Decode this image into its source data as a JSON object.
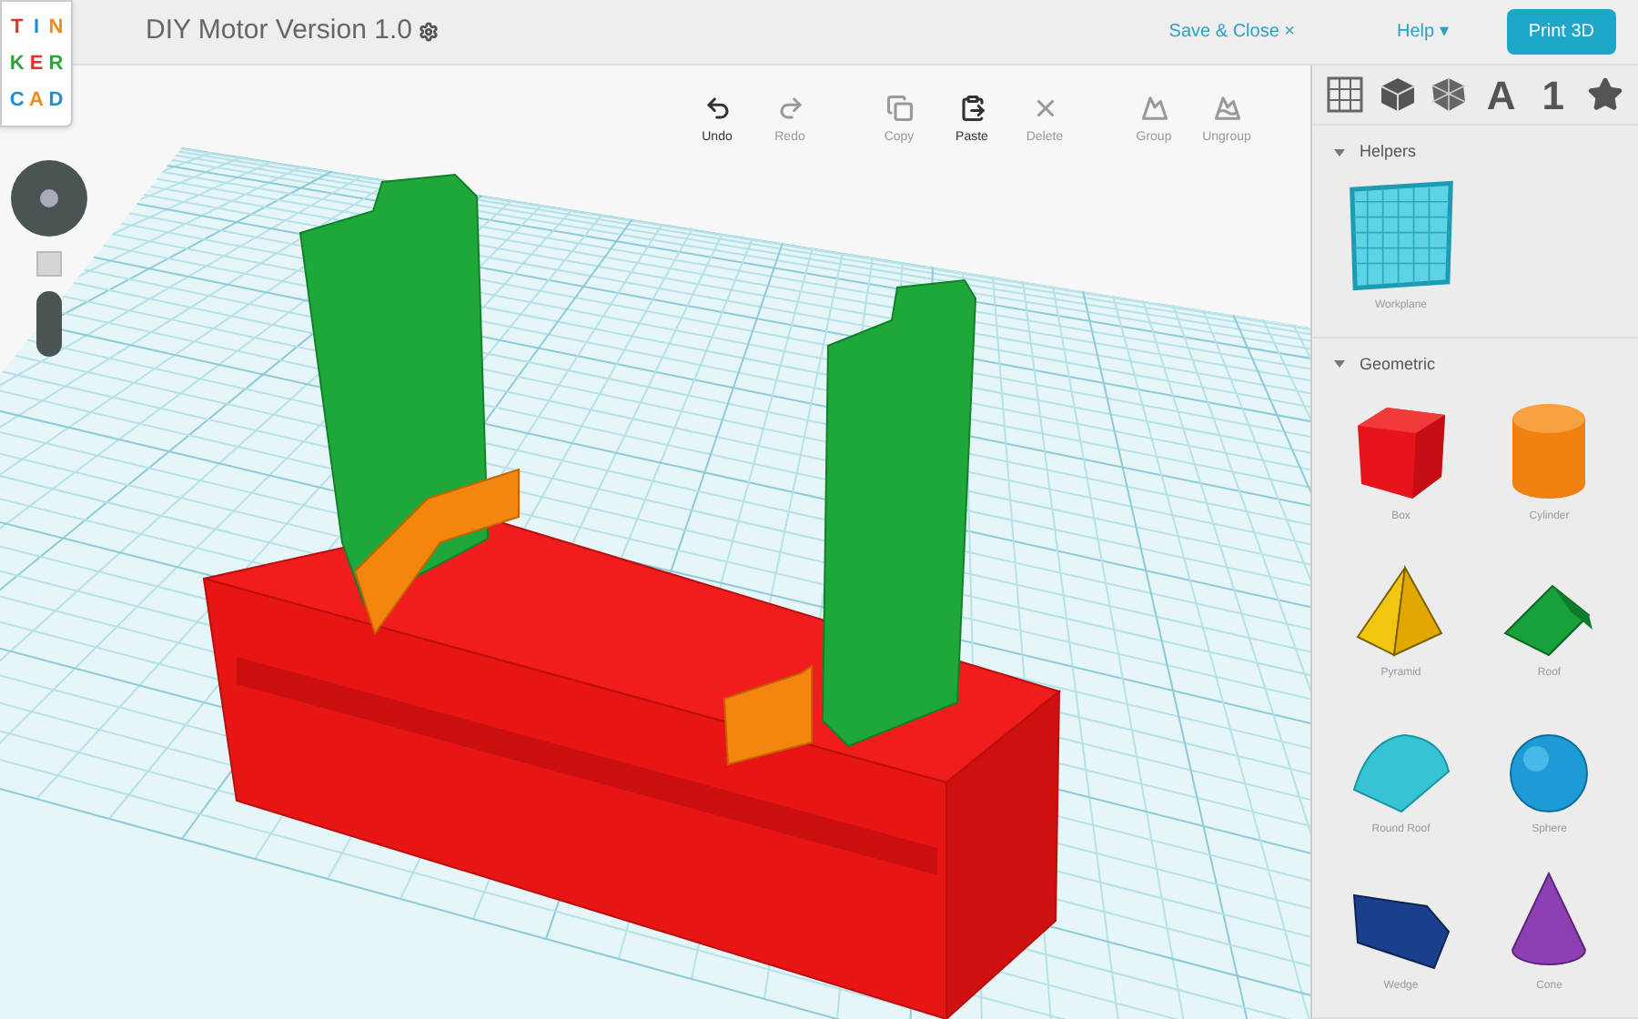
{
  "logo": {
    "letters": [
      {
        "char": "T",
        "color": "#e5302a"
      },
      {
        "char": "I",
        "color": "#1a8fd6"
      },
      {
        "char": "N",
        "color": "#f28b1c"
      },
      {
        "char": "K",
        "color": "#2aa53b"
      },
      {
        "char": "E",
        "color": "#e5302a"
      },
      {
        "char": "R",
        "color": "#2aa53b"
      },
      {
        "char": "C",
        "color": "#1a8fd6"
      },
      {
        "char": "A",
        "color": "#f28b1c"
      },
      {
        "char": "D",
        "color": "#1a8fd6"
      }
    ]
  },
  "title": "DIY Motor Version 1.0",
  "header": {
    "save_close": "Save & Close",
    "save_close_icon": "×",
    "help": "Help",
    "help_icon": "▾",
    "print_button": "Print 3D"
  },
  "toolbar": [
    {
      "kind": "undo",
      "label": "Undo",
      "disabled": false
    },
    {
      "kind": "redo",
      "label": "Redo",
      "disabled": true
    },
    {
      "kind": "copy",
      "label": "Copy",
      "disabled": true
    },
    {
      "kind": "paste",
      "label": "Paste",
      "disabled": false
    },
    {
      "kind": "delete",
      "label": "Delete",
      "disabled": true
    },
    {
      "kind": "group",
      "label": "Group",
      "disabled": true
    },
    {
      "kind": "ungroup",
      "label": "Ungroup",
      "disabled": true
    }
  ],
  "sidebar": {
    "tabs": [
      {
        "kind": "grid"
      },
      {
        "kind": "cube"
      },
      {
        "kind": "sphere"
      },
      {
        "kind": "text",
        "label": "A"
      },
      {
        "kind": "text",
        "label": "1"
      },
      {
        "kind": "star"
      }
    ],
    "sections": [
      {
        "title": "Helpers",
        "expanded": true,
        "items": [
          {
            "kind": "workplane",
            "label": "Workplane"
          }
        ]
      },
      {
        "title": "Geometric",
        "expanded": true,
        "items": [
          {
            "kind": "box",
            "label": "Box"
          },
          {
            "kind": "cylinder",
            "label": "Cylinder"
          },
          {
            "kind": "pyramid",
            "label": "Pyramid"
          },
          {
            "kind": "roof",
            "label": "Roof"
          },
          {
            "kind": "roundroof",
            "label": "Round Roof"
          },
          {
            "kind": "sphere",
            "label": "Sphere"
          },
          {
            "kind": "wedge",
            "label": "Wedge"
          },
          {
            "kind": "cone",
            "label": "Cone"
          }
        ]
      }
    ]
  }
}
